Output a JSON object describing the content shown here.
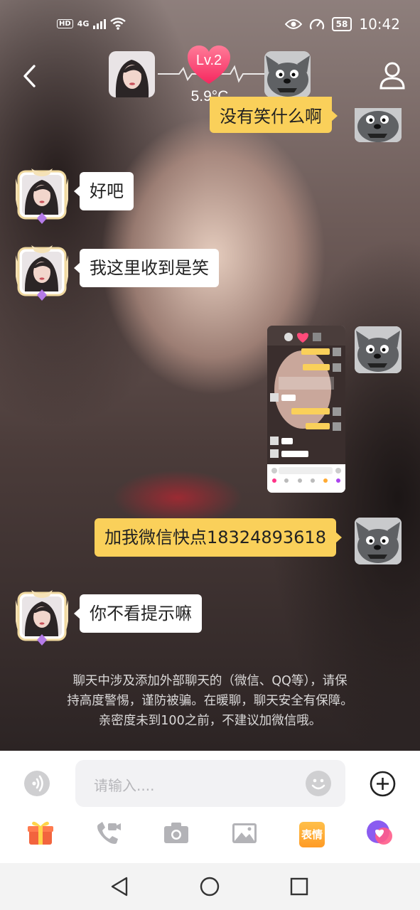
{
  "status_bar": {
    "hd": "HD",
    "network": "4G",
    "battery": "58",
    "time": "10:42"
  },
  "header": {
    "level": "Lv.2",
    "temperature": "5.9°C"
  },
  "messages": [
    {
      "side": "right",
      "text": "没有笑什么啊"
    },
    {
      "side": "left",
      "text": "好吧"
    },
    {
      "side": "left",
      "text": "我这里收到是笑"
    },
    {
      "side": "right",
      "type": "image"
    },
    {
      "side": "right",
      "text": "加我微信快点18324893618"
    },
    {
      "side": "left",
      "text": "你不看提示嘛"
    }
  ],
  "notice": {
    "line1": "聊天中涉及添加外部聊天的（微信、QQ等），请保",
    "line2": "持高度警惕，谨防被骗。在暖聊，聊天安全有保障。",
    "line3": "亲密度未到100之前，不建议加微信哦。"
  },
  "input": {
    "placeholder": "请输入...."
  },
  "toolbar": {
    "sticker_label": "表情",
    "icons": [
      "gift-icon",
      "video-call-icon",
      "camera-icon",
      "image-icon",
      "sticker-icon",
      "chat-bubble-icon"
    ]
  },
  "colors": {
    "bubble_self": "#fad05a",
    "bubble_other": "#ffffff",
    "heart": "#ff4b7a"
  }
}
